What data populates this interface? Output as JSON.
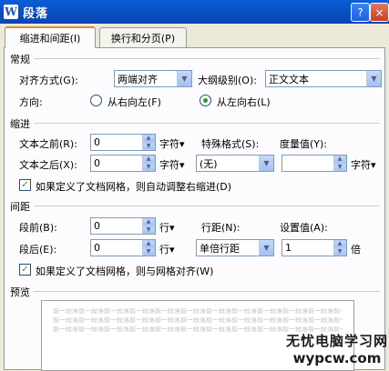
{
  "window": {
    "app_icon": "W",
    "title": "段落",
    "help_icon": "?",
    "close_icon": "×"
  },
  "tabs": [
    {
      "label": "缩进和间距(I)",
      "active": true
    },
    {
      "label": "换行和分页(P)",
      "active": false
    }
  ],
  "general": {
    "section": "常规",
    "alignment_label": "对齐方式(G):",
    "alignment_value": "两端对齐",
    "outline_label": "大纲级别(O):",
    "outline_value": "正文文本",
    "direction_label": "方向:",
    "rtl_label": "从右向左(F)",
    "ltr_label": "从左向右(L)",
    "direction_selected": "ltr"
  },
  "indent": {
    "section": "缩进",
    "before_label": "文本之前(R):",
    "before_value": "0",
    "before_unit": "字符▾",
    "after_label": "文本之后(X):",
    "after_value": "0",
    "after_unit": "字符▾",
    "special_label": "特殊格式(S):",
    "special_value": "(无)",
    "measure_label": "度量值(Y):",
    "measure_value": "",
    "measure_unit": "字符▾",
    "grid_check_label": "如果定义了文档网格，则自动调整右缩进(D)",
    "grid_checked": true
  },
  "spacing": {
    "section": "间距",
    "before_label": "段前(B):",
    "before_value": "0",
    "before_unit": "行▾",
    "after_label": "段后(E):",
    "after_value": "0",
    "after_unit": "行▾",
    "line_label": "行距(N):",
    "line_value": "单倍行距",
    "setting_label": "设置值(A):",
    "setting_value": "1",
    "setting_unit": "倍",
    "grid_check_label": "如果定义了文档网格，则与网格对齐(W)",
    "grid_checked": true
  },
  "preview": {
    "section": "预览",
    "sample_line": "前一段落前一段落前一段落前一段落前一段落前一段落前一段落前一段落前一段落前一段落前一段落前一段落"
  },
  "watermark": {
    "site_name": "无忧电脑学习网",
    "url": "wypcw.com"
  }
}
